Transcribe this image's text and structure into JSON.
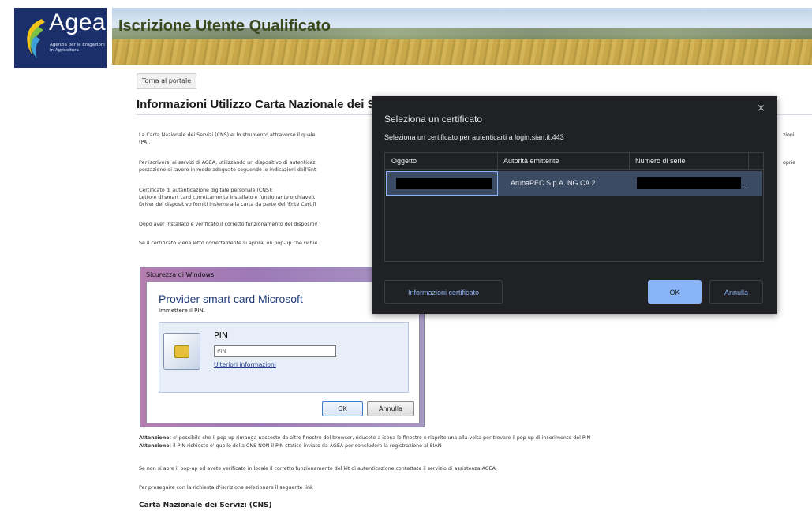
{
  "header": {
    "logo_name": "Agea",
    "logo_subtitle": "Agenzia per le Erogazioni in Agricoltura",
    "banner_title": "Iscrizione Utente Qualificato"
  },
  "page": {
    "back_button": "Torna al portale",
    "title": "Informazioni Utilizzo Carta Nazionale dei Se",
    "paragraphs": [
      "La Carta Nazionale dei Servizi (CNS) e' lo strumento attraverso il quale",
      "(PA).",
      "Per iscriversi ai servizi di AGEA, utilizzando un dispositivo di autenticaz",
      "postazione di lavoro in modo adeguato seguendo le indicazioni dell'Ent",
      "Certificato di autenticazione digitale personale (CNS):",
      "Lettore di smart card correttamente installato e funzionante o chiavett",
      "Driver del dispositivo forniti insieme alla carta da parte dell'Ente Certifi",
      "Dopo aver installato e verificato il corretto funzionamento del dispositiv",
      "Se il certificato viene letto correttamente si aprira' un pop-up che richie"
    ],
    "right_fragment_1": "zioni",
    "right_fragment_2": "oprie",
    "warning_1_label": "Attenzione:",
    "warning_1_text": "e' possibile che il pop-up rimanga nascosto da altre finestre del browser, riducete a icona le finestre e riaprite una alla volta per trovare il pop-up di inserimento del PIN",
    "warning_2_label": "Attenzione:",
    "warning_2_text": "il PIN richiesto e' quello della CNS NON il PIN statico inviato da AGEA per concludere la registrazione al SIAN",
    "support_text": "Se non si apre il pop-up ed avete verificato in locale il corretto funzionamento del kit di autenticazione contattate il servizio di assistenza AGEA.",
    "proceed_text": "Per proseguire con la richiesta d'iscrizione selezionare il seguente link",
    "cns_title": "Carta Nazionale dei Servizi (CNS)"
  },
  "windows_security": {
    "title": "Sicurezza di Windows",
    "provider": "Provider smart card Microsoft",
    "hint": "Immettere il PIN.",
    "pin_label": "PIN",
    "pin_placeholder": "PIN",
    "more_info_link": "Ulteriori informazioni",
    "ok_label": "OK",
    "cancel_label": "Annulla"
  },
  "cert_dialog": {
    "title": "Seleziona un certificato",
    "close_symbol": "×",
    "subtitle": "Seleziona un certificato per autenticarti a login.sian.it:443",
    "columns": [
      "Oggetto",
      "Autorità emittente",
      "Numero di serie"
    ],
    "rows": [
      {
        "issuer": "ArubaPEC S.p.A. NG CA 2",
        "serial_suffix": "..."
      }
    ],
    "info_button": "Informazioni certificato",
    "ok_button": "OK",
    "cancel_button": "Annulla"
  },
  "colors": {
    "dialog_bg": "#202124",
    "dialog_accent": "#8ab4f8",
    "selected_row": "#3a4b63",
    "logo_bg": "#1b2f6b"
  }
}
